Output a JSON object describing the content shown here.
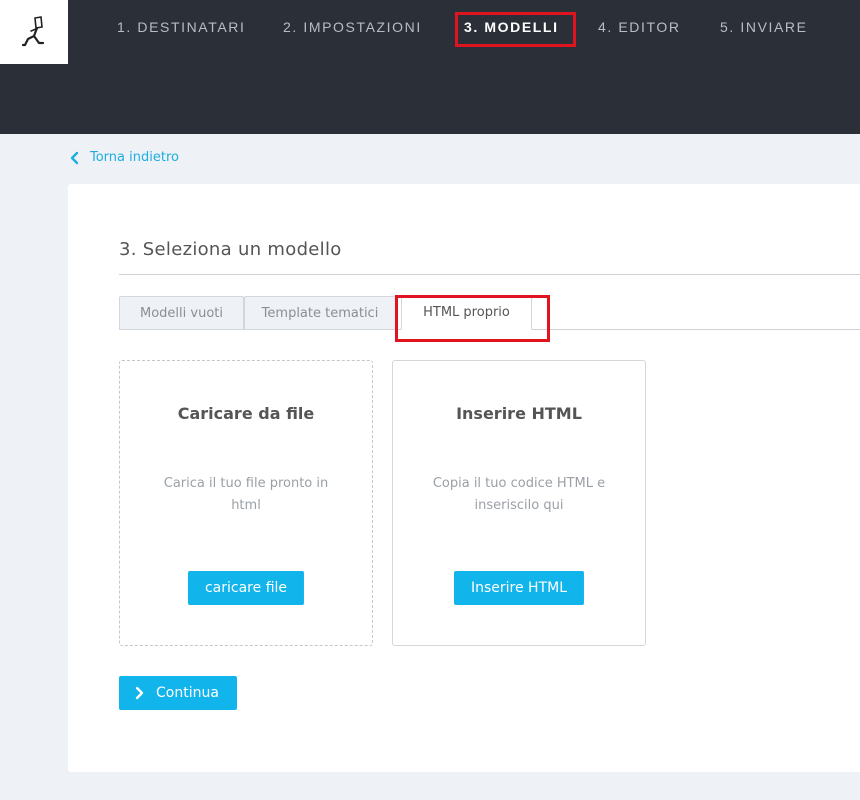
{
  "steps": [
    {
      "label": "1. DESTINATARI"
    },
    {
      "label": "2. IMPOSTAZIONI"
    },
    {
      "label": "3. MODELLI"
    },
    {
      "label": "4. EDITOR"
    },
    {
      "label": "5. INVIARE"
    }
  ],
  "active_step": "3. MODELLI",
  "back_link": "Torna indietro",
  "title": "3. Seleziona un modello",
  "tabs": [
    {
      "label": "Modelli vuoti"
    },
    {
      "label": "Template tematici"
    },
    {
      "label": "HTML proprio"
    }
  ],
  "active_tab": "HTML proprio",
  "cards": [
    {
      "title": "Caricare da file",
      "description": "Carica il tuo file pronto in html",
      "button": "caricare file"
    },
    {
      "title": "Inserire HTML",
      "description": "Copia il tuo codice HTML e inseriscilo qui",
      "button": "Inserire HTML"
    }
  ],
  "continue_label": "Continua",
  "colors": {
    "accent": "#12b4ec",
    "highlight": "#e0141e",
    "header": "#2b2f38",
    "link": "#1eaee0"
  },
  "icons": {
    "logo": "mascot-logo",
    "back": "chevron-left-icon",
    "continue": "chevron-right-icon"
  }
}
